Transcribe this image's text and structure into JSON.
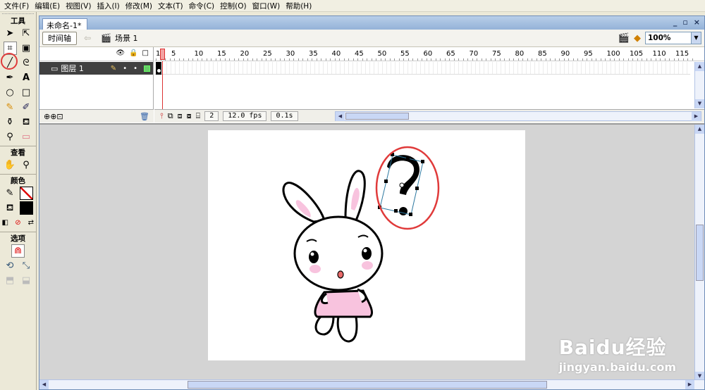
{
  "menubar": {
    "items": [
      "文件(F)",
      "编辑(E)",
      "视图(V)",
      "插入(I)",
      "修改(M)",
      "文本(T)",
      "命令(C)",
      "控制(O)",
      "窗口(W)",
      "帮助(H)"
    ]
  },
  "tools": {
    "title": "工具",
    "view_title": "查看",
    "colors_title": "颜色",
    "options_title": "选项",
    "highlight_color": "#e03a3a"
  },
  "document": {
    "tab_title": "未命名-1*",
    "window_buttons": [
      "_",
      "▫",
      "×"
    ]
  },
  "scene_bar": {
    "timeline_button": "时间轴",
    "scene_label": "场景 1",
    "zoom_value": "100%"
  },
  "timeline": {
    "layer_name": "图层 1",
    "ruler_numbers": [
      "1",
      "5",
      "10",
      "15",
      "20",
      "25",
      "30",
      "35",
      "40",
      "45",
      "50",
      "55",
      "60",
      "65",
      "70",
      "75",
      "80",
      "85",
      "90",
      "95",
      "100",
      "105",
      "110",
      "115"
    ],
    "current_frame": "2",
    "frame_rate": "12.0 fps",
    "elapsed_time": "0.1s"
  },
  "watermark": {
    "brand": "Baidu经验",
    "url": "jingyan.baidu.com"
  }
}
